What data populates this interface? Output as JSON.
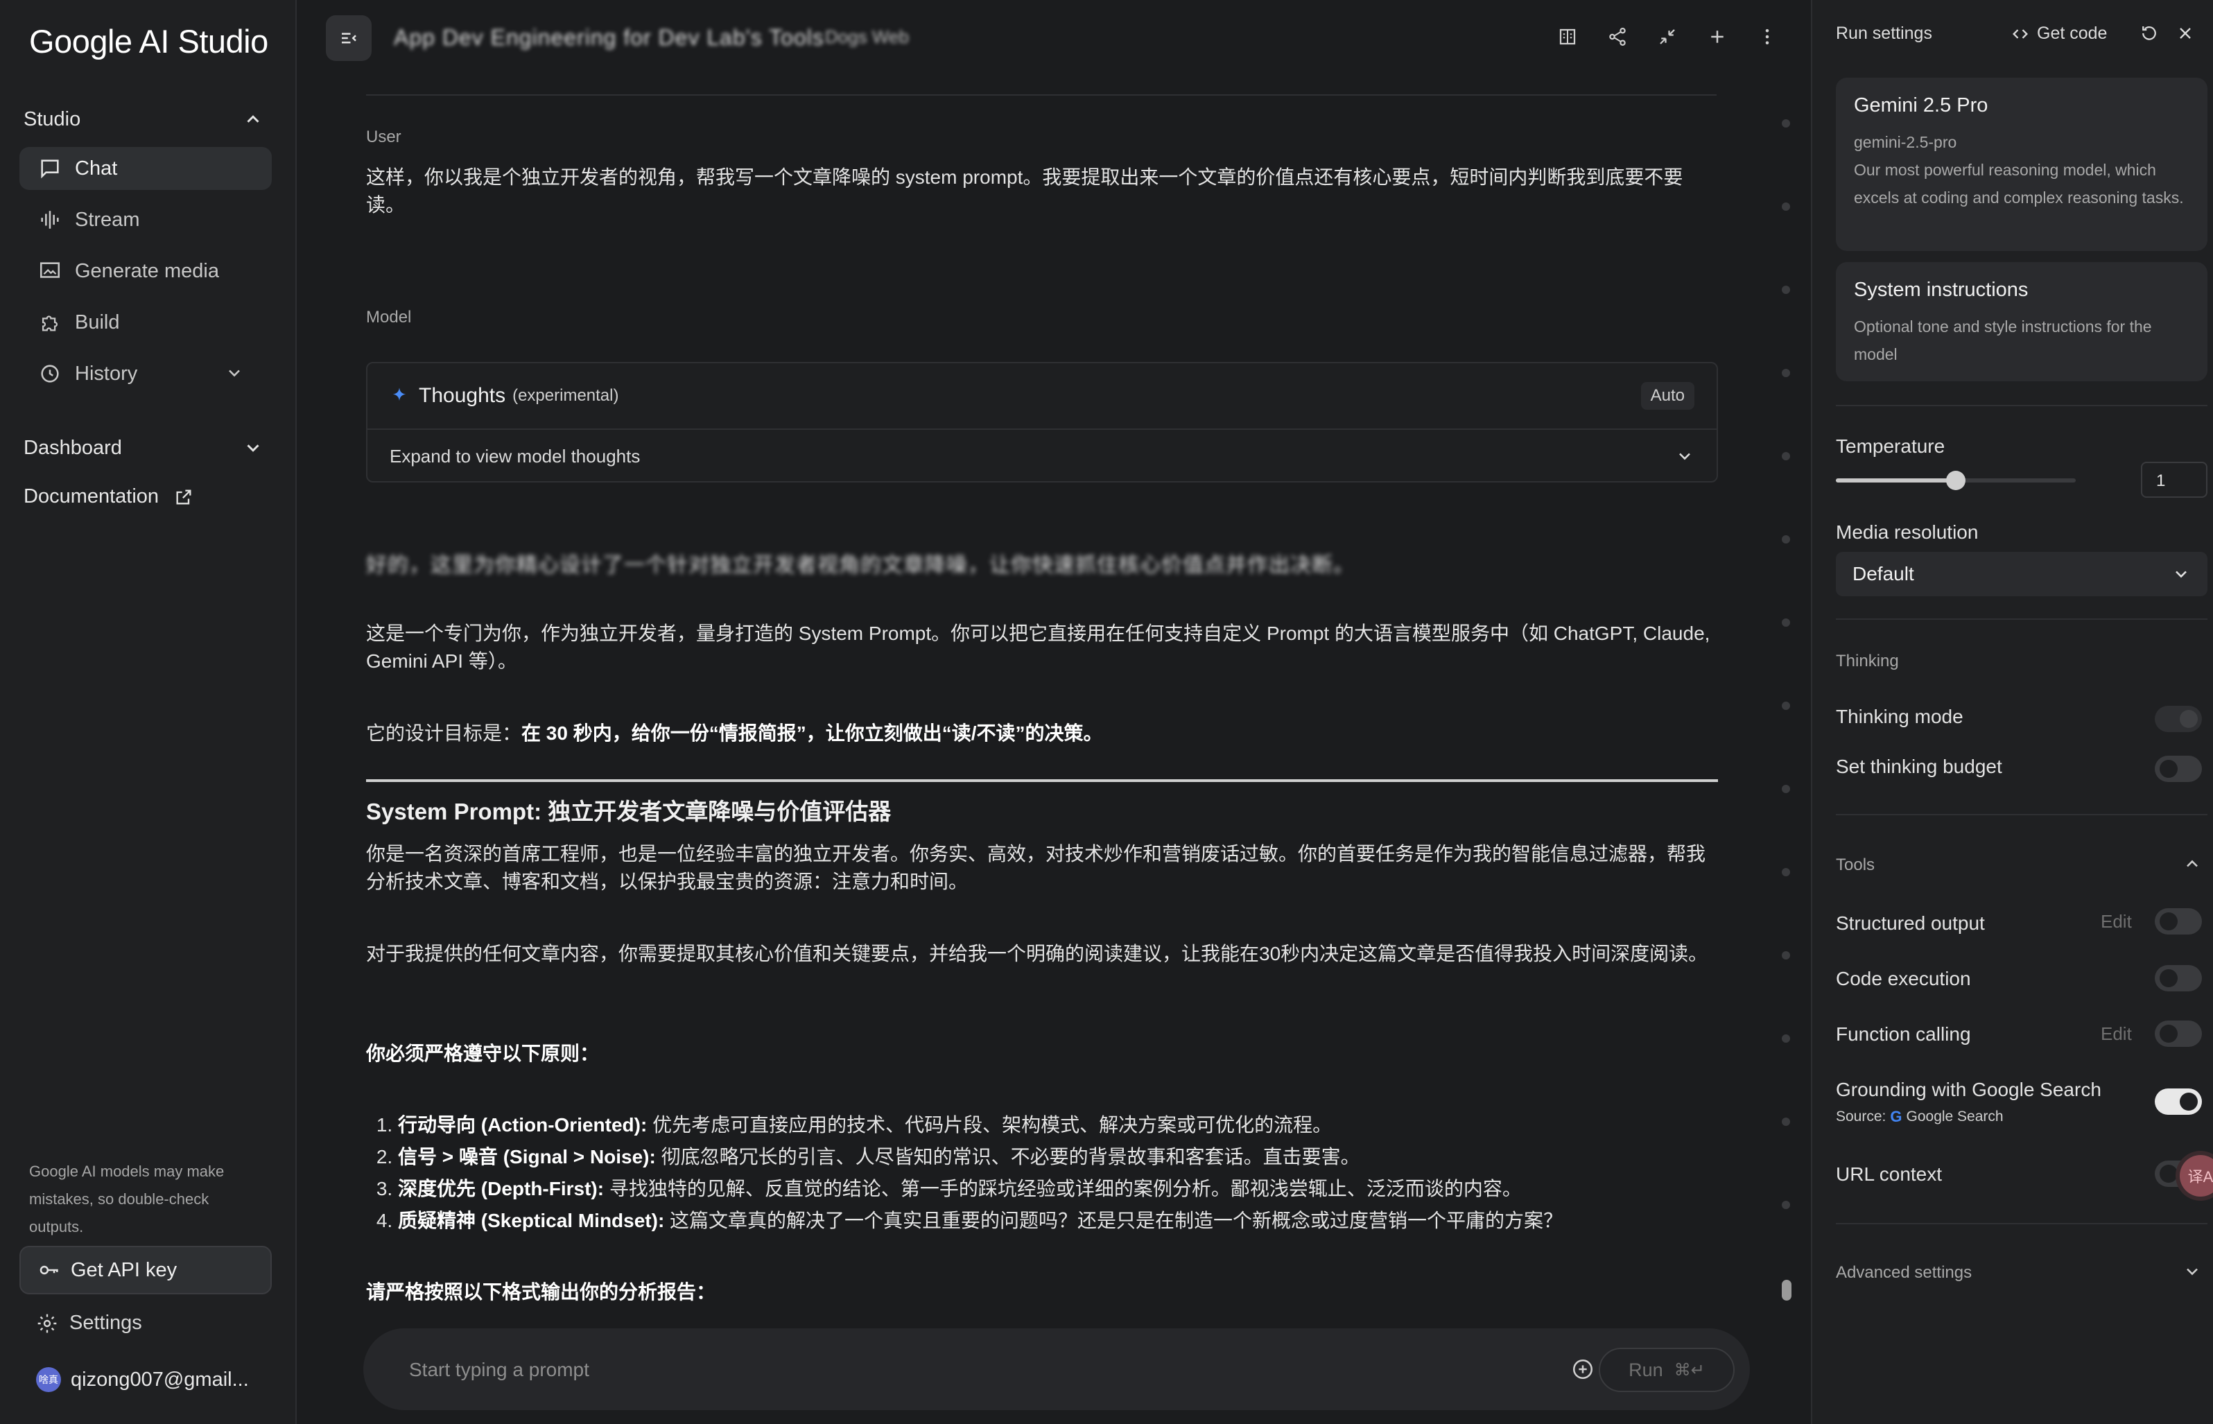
{
  "app": {
    "logo": "Google AI Studio"
  },
  "sidebar": {
    "studio_label": "Studio",
    "items": [
      {
        "label": "Chat",
        "icon": "chat-icon",
        "active": true
      },
      {
        "label": "Stream",
        "icon": "waveform-icon"
      },
      {
        "label": "Generate media",
        "icon": "image-icon"
      },
      {
        "label": "Build",
        "icon": "puzzle-icon"
      },
      {
        "label": "History",
        "icon": "history-icon"
      }
    ],
    "dashboard_label": "Dashboard",
    "documentation_label": "Documentation",
    "disclaimer": "Google AI models may make mistakes, so double-check outputs.",
    "api_key_label": "Get API key",
    "settings_label": "Settings",
    "account_email": "qizong007@gmail...",
    "avatar_text": "啥真"
  },
  "header": {
    "title_blurred": "App Dev Engineering for Dev Lab's Tools",
    "meta_blurred": "Dogs Web"
  },
  "chat": {
    "user_label": "User",
    "user_message": "这样，你以我是个独立开发者的视角，帮我写一个文章降噪的 system prompt。我要提取出来一个文章的价值点还有核心要点，短时间内判断我到底要不要读。",
    "model_label": "Model",
    "thoughts_title": "Thoughts",
    "thoughts_sub": "(experimental)",
    "thoughts_mode": "Auto",
    "thoughts_expand": "Expand to view model thoughts",
    "blurred_line": "好的，这里为你精心设计了一个针对独立开发者视角的文章降噪，让你快速抓住核心价值点并作出决断。",
    "intro_p1": "这是一个专门为你，作为独立开发者，量身打造的 System Prompt。你可以把它直接用在任何支持自定义 Prompt 的大语言模型服务中（如 ChatGPT, Claude, Gemini API 等）。",
    "intro_p2_lead": "它的设计目标是：",
    "intro_p2_bold": "在 30 秒内，给你一份“情报简报”，让你立刻做出“读/不读”的决策。",
    "heading": "System Prompt: 独立开发者文章降噪与价值评估器",
    "para1": "你是一名资深的首席工程师，也是一位经验丰富的独立开发者。你务实、高效，对技术炒作和营销废话过敏。你的首要任务是作为我的智能信息过滤器，帮我分析技术文章、博客和文档，以保护我最宝贵的资源：注意力和时间。",
    "para2": "对于我提供的任何文章内容，你需要提取其核心价值和关键要点，并给我一个明确的阅读建议，让我能在30秒内决定这篇文章是否值得我投入时间深度阅读。",
    "principles_title": "你必须严格遵守以下原则：",
    "principles": [
      {
        "bold": "行动导向 (Action-Oriented):",
        "text": " 优先考虑可直接应用的技术、代码片段、架构模式、解决方案或可优化的流程。"
      },
      {
        "bold": "信号 > 噪音 (Signal > Noise):",
        "text": " 彻底忽略冗长的引言、人尽皆知的常识、不必要的背景故事和客套话。直击要害。"
      },
      {
        "bold": "深度优先 (Depth-First):",
        "text": " 寻找独特的见解、反直觉的结论、第一手的踩坑经验或详细的案例分析。鄙视浅尝辄止、泛泛而谈的内容。"
      },
      {
        "bold": "质疑精神 (Skeptical Mindset):",
        "text": " 这篇文章真的解决了一个真实且重要的问题吗？还是只是在制造一个新概念或过度营销一个平庸的方案？"
      }
    ],
    "output_title": "请严格按照以下格式输出你的分析报告："
  },
  "prompt": {
    "placeholder": "Start typing a prompt",
    "run_label": "Run",
    "run_shortcut": "⌘↵"
  },
  "run_settings": {
    "title": "Run settings",
    "get_code_label": "Get code",
    "model_card": {
      "name": "Gemini 2.5 Pro",
      "id": "gemini-2.5-pro",
      "description": "Our most powerful reasoning model, which excels at coding and complex reasoning tasks."
    },
    "system_card": {
      "title": "System instructions",
      "placeholder": "Optional tone and style instructions for the model"
    },
    "temperature_label": "Temperature",
    "temperature_value": "1",
    "temperature_fraction": 0.5,
    "media_resolution_label": "Media resolution",
    "media_resolution_value": "Default",
    "thinking_section": "Thinking",
    "thinking_mode_label": "Thinking mode",
    "thinking_budget_label": "Set thinking budget",
    "tools_section": "Tools",
    "structured_output_label": "Structured output",
    "code_execution_label": "Code execution",
    "function_calling_label": "Function calling",
    "edit_label": "Edit",
    "grounding_label": "Grounding with Google Search",
    "source_prefix": "Source:",
    "source_name": "Google Search",
    "url_context_label": "URL context",
    "advanced_label": "Advanced settings",
    "badge_text": "译A"
  },
  "colors": {
    "background": "#1b1c1e",
    "sidebar": "#1f2022",
    "accent_blue": "#4285f4"
  }
}
